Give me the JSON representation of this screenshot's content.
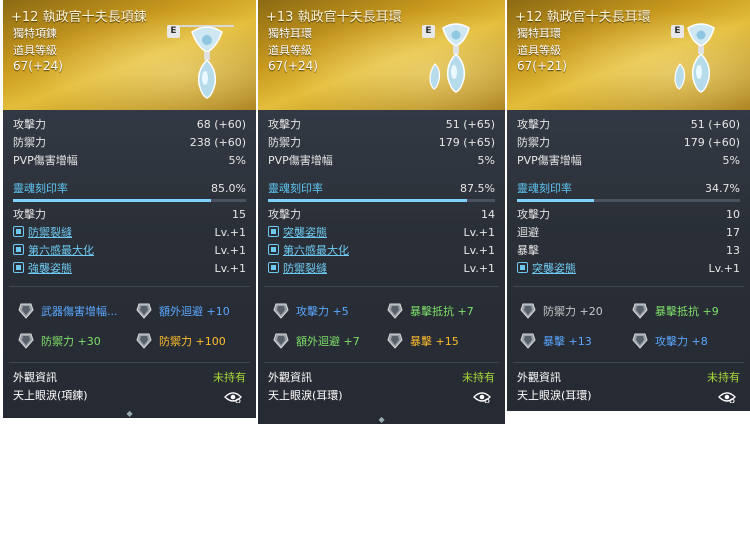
{
  "cards": [
    {
      "title": "+12 執政官十夫長項鍊",
      "badge": "E",
      "type": "獨特項鍊",
      "level_label": "道具等級",
      "level": "67(+24)",
      "stats": [
        {
          "label": "攻擊力",
          "value": "68 (+60)"
        },
        {
          "label": "防禦力",
          "value": "238 (+60)"
        },
        {
          "label": "PVP傷害增幅",
          "value": "5%"
        }
      ],
      "soul": {
        "label": "靈魂刻印率",
        "value": "85.0%",
        "fill": 0.85
      },
      "soul_stats": [
        {
          "label": "攻擊力",
          "value": "15"
        }
      ],
      "skills": [
        {
          "label": "防禦裂縫",
          "value": "Lv.+1"
        },
        {
          "label": "第六感最大化",
          "value": "Lv.+1"
        },
        {
          "label": "強襲姿態",
          "value": "Lv.+1"
        }
      ],
      "stones": [
        {
          "text": "武器傷害增幅...",
          "value": "",
          "color": "blue"
        },
        {
          "text": "額外迴避",
          "value": "+10",
          "color": "blue"
        },
        {
          "text": "防禦力",
          "value": "+30",
          "color": "green"
        },
        {
          "text": "防禦力",
          "value": "+100",
          "color": "gold"
        }
      ],
      "appearance_label": "外觀資訊",
      "appearance_status": "未持有",
      "appearance_name": "天上眼淚(項鍊)"
    },
    {
      "title": "+13 執政官十夫長耳環",
      "badge": "E",
      "type": "獨特耳環",
      "level_label": "道具等級",
      "level": "67(+24)",
      "stats": [
        {
          "label": "攻擊力",
          "value": "51 (+65)"
        },
        {
          "label": "防禦力",
          "value": "179 (+65)"
        },
        {
          "label": "PVP傷害增幅",
          "value": "5%"
        }
      ],
      "soul": {
        "label": "靈魂刻印率",
        "value": "87.5%",
        "fill": 0.875
      },
      "soul_stats": [
        {
          "label": "攻擊力",
          "value": "14"
        }
      ],
      "skills": [
        {
          "label": "突襲姿態",
          "value": "Lv.+1"
        },
        {
          "label": "第六感最大化",
          "value": "Lv.+1"
        },
        {
          "label": "防禦裂縫",
          "value": "Lv.+1"
        }
      ],
      "stones": [
        {
          "text": "攻擊力",
          "value": "+5",
          "color": "blue"
        },
        {
          "text": "暴擊抵抗",
          "value": "+7",
          "color": "green"
        },
        {
          "text": "額外迴避",
          "value": "+7",
          "color": "green"
        },
        {
          "text": "暴擊",
          "value": "+15",
          "color": "gold"
        }
      ],
      "appearance_label": "外觀資訊",
      "appearance_status": "未持有",
      "appearance_name": "天上眼淚(耳環)"
    },
    {
      "title": "+12 執政官十夫長耳環",
      "badge": "E",
      "type": "獨特耳環",
      "level_label": "道具等級",
      "level": "67(+21)",
      "stats": [
        {
          "label": "攻擊力",
          "value": "51 (+60)"
        },
        {
          "label": "防禦力",
          "value": "179 (+60)"
        },
        {
          "label": "PVP傷害增幅",
          "value": "5%"
        }
      ],
      "soul": {
        "label": "靈魂刻印率",
        "value": "34.7%",
        "fill": 0.347
      },
      "soul_stats": [
        {
          "label": "攻擊力",
          "value": "10"
        },
        {
          "label": "迴避",
          "value": "17"
        },
        {
          "label": "暴擊",
          "value": "13"
        }
      ],
      "skills": [
        {
          "label": "突襲姿態",
          "value": "Lv.+1"
        }
      ],
      "stones": [
        {
          "text": "防禦力",
          "value": "+20",
          "color": "gray"
        },
        {
          "text": "暴擊抵抗",
          "value": "+9",
          "color": "green"
        },
        {
          "text": "暴擊",
          "value": "+13",
          "color": "blue"
        },
        {
          "text": "攻擊力",
          "value": "+8",
          "color": "blue"
        }
      ],
      "appearance_label": "外觀資訊",
      "appearance_status": "未持有",
      "appearance_name": "天上眼淚(耳環)"
    }
  ]
}
